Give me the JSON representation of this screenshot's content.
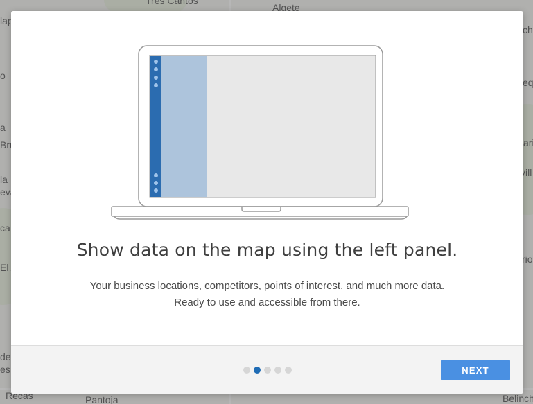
{
  "map": {
    "place_labels": [
      "Tres Cantos",
      "Algete",
      "lap",
      "ch",
      "o",
      "eq",
      "a",
      "Bru",
      "ari",
      "la",
      "eva",
      "vill",
      "ca",
      "El A",
      "rio",
      "de",
      "es",
      "Recas",
      "Pantoja",
      "Belinch"
    ]
  },
  "modal": {
    "title": "Show data on the map using the left panel.",
    "description_line1": "Your business locations, competitors, points of interest, and much more data.",
    "description_line2": "Ready to use and accessible from there.",
    "pagination": {
      "total": 5,
      "active_index": 1
    },
    "next_label": "NEXT"
  },
  "colors": {
    "accent": "#4a90e2",
    "dot_active": "#1f6cb5",
    "dot_inactive": "#d6d6d6",
    "panel_strip": "#2b6cb0",
    "panel": "#adc4dc",
    "screen": "#e8e8e8"
  },
  "icons": [
    "laptop-illustration"
  ]
}
